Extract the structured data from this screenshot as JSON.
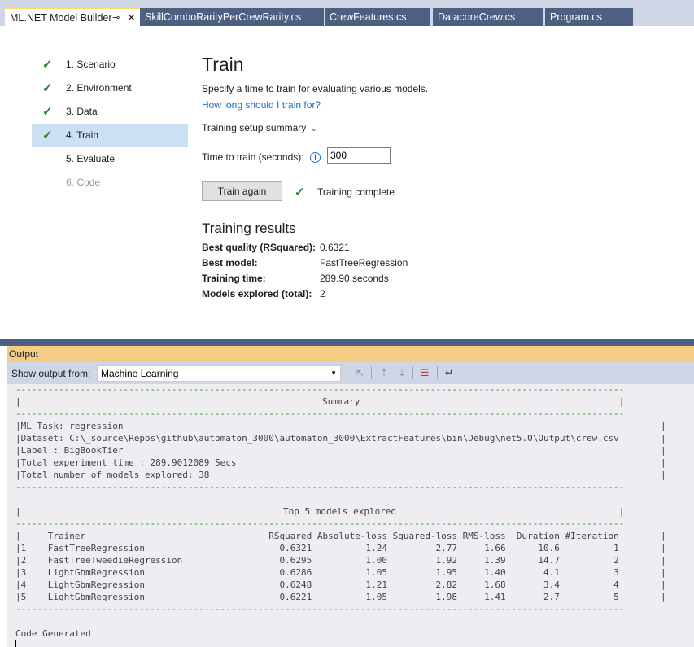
{
  "tabs": [
    {
      "label": "ML.NET Model Builder",
      "active": true
    },
    {
      "label": "SkillComboRarityPerCrewRarity.cs",
      "active": false
    },
    {
      "label": "CrewFeatures.cs",
      "active": false
    },
    {
      "label": "DatacoreCrew.cs",
      "active": false
    },
    {
      "label": "Program.cs",
      "active": false
    }
  ],
  "steps": [
    {
      "label": "1. Scenario",
      "done": true
    },
    {
      "label": "2. Environment",
      "done": true
    },
    {
      "label": "3. Data",
      "done": true
    },
    {
      "label": "4. Train",
      "done": true,
      "selected": true
    },
    {
      "label": "5. Evaluate",
      "done": false
    },
    {
      "label": "6. Code",
      "done": false,
      "disabled": true
    }
  ],
  "train": {
    "title": "Train",
    "description": "Specify a time to train for evaluating models.",
    "description_full": "Specify a time to train for evaluating various models.",
    "help_link": "How long should I train for?",
    "summary_toggle": "Training setup summary",
    "time_label": "Time to train (seconds):",
    "time_value": "300",
    "train_button": "Train again",
    "status": "Training complete"
  },
  "results": {
    "title": "Training results",
    "rows": [
      {
        "key": "Best quality (RSquared):",
        "value": "0.6321"
      },
      {
        "key": "Best model:",
        "value": "FastTreeRegression"
      },
      {
        "key": "Training time:",
        "value": "289.90 seconds"
      },
      {
        "key": "Models explored (total):",
        "value": "2"
      }
    ]
  },
  "output": {
    "title": "Output",
    "show_from_label": "Show output from:",
    "source": "Machine Learning",
    "summary_title": "Summary",
    "ml_task": "|ML Task: regression",
    "dataset": "|Dataset: C:\\_source\\Repos\\github\\automaton_3000\\automaton_3000\\ExtractFeatures\\bin\\Debug\\net5.0\\Output\\crew.csv",
    "label_line": "|Label : BigBookTier",
    "time_line": "|Total experiment time : 289.9012089 Secs",
    "models_line": "|Total number of models explored: 38",
    "top_title": "Top 5 models explored",
    "header": "|     Trainer                                  RSquared Absolute-loss Squared-loss RMS-loss  Duration #Iteration",
    "rows": [
      "|1    FastTreeRegression                         0.6321          1.24         2.77     1.66      10.6          1",
      "|2    FastTreeTweedieRegression                  0.6295          1.00         1.92     1.39      14.7          2",
      "|3    LightGbmRegression                         0.6286          1.05         1.95     1.40       4.1          3",
      "|4    LightGbmRegression                         0.6248          1.21         2.82     1.68       3.4          4",
      "|5    LightGbmRegression                         0.6221          1.05         1.98     1.41       2.7          5"
    ],
    "code_generated": "Code Generated"
  }
}
